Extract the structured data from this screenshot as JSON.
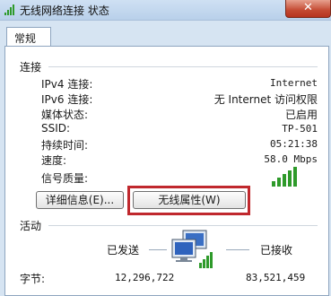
{
  "window": {
    "title": "无线网络连接 状态",
    "close_glyph": "✕"
  },
  "tabs": [
    {
      "label": "常规"
    }
  ],
  "connection": {
    "group_label": "连接",
    "rows": [
      {
        "label": "IPv4 连接:",
        "value": "Internet"
      },
      {
        "label": "IPv6 连接:",
        "value": "无 Internet 访问权限"
      },
      {
        "label": "媒体状态:",
        "value": "已启用"
      },
      {
        "label": "SSID:",
        "value": "TP-501"
      },
      {
        "label": "持续时间:",
        "value": "05:21:38"
      },
      {
        "label": "速度:",
        "value": "58.0 Mbps"
      }
    ],
    "signal_label": "信号质量:",
    "signal_bars": 5
  },
  "buttons": {
    "details": "详细信息(E)...",
    "wireless_props": "无线属性(W)"
  },
  "activity": {
    "group_label": "活动",
    "sent_label": "已发送",
    "received_label": "已接收",
    "bytes_label": "字节:",
    "bytes_sent": "12,296,722",
    "bytes_received": "83,521,459"
  },
  "colors": {
    "highlight": "#c0282d",
    "signal": "#2e9a2a"
  }
}
